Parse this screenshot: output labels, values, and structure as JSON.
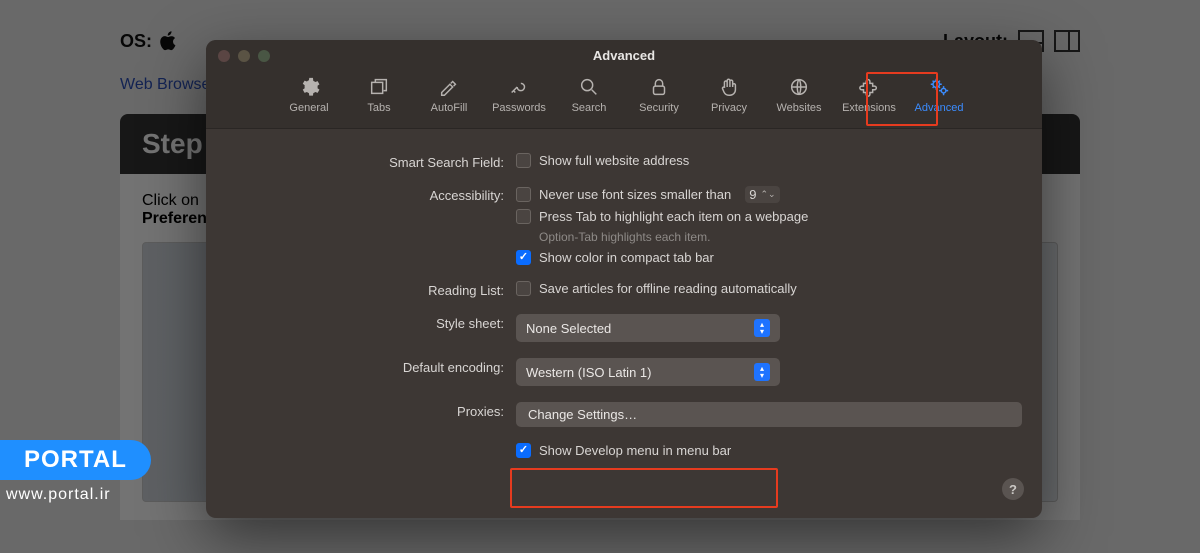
{
  "background": {
    "os_label": "OS:",
    "layout_label": "Layout:",
    "breadcrumb": "Web Browse",
    "step_title": "Step",
    "step_text_1": "Click on",
    "step_text_2": "Preferen"
  },
  "portal": {
    "name": "PORTAL",
    "url": "www.portal.ir"
  },
  "prefs": {
    "title": "Advanced",
    "toolbar": [
      {
        "id": "general",
        "label": "General"
      },
      {
        "id": "tabs",
        "label": "Tabs"
      },
      {
        "id": "autofill",
        "label": "AutoFill"
      },
      {
        "id": "passwords",
        "label": "Passwords"
      },
      {
        "id": "search",
        "label": "Search"
      },
      {
        "id": "security",
        "label": "Security"
      },
      {
        "id": "privacy",
        "label": "Privacy"
      },
      {
        "id": "websites",
        "label": "Websites"
      },
      {
        "id": "extensions",
        "label": "Extensions"
      },
      {
        "id": "advanced",
        "label": "Advanced"
      }
    ],
    "smart_search": {
      "label": "Smart Search Field:",
      "cb_full_address": "Show full website address"
    },
    "accessibility": {
      "label": "Accessibility:",
      "cb_font_size": "Never use font sizes smaller than",
      "font_value": "9",
      "cb_tab_highlight": "Press Tab to highlight each item on a webpage",
      "hint": "Option-Tab highlights each item.",
      "cb_compact_color": "Show color in compact tab bar"
    },
    "reading_list": {
      "label": "Reading List:",
      "cb_offline": "Save articles for offline reading automatically"
    },
    "style_sheet": {
      "label": "Style sheet:",
      "value": "None Selected"
    },
    "encoding": {
      "label": "Default encoding:",
      "value": "Western (ISO Latin 1)"
    },
    "proxies": {
      "label": "Proxies:",
      "button": "Change Settings…"
    },
    "develop": {
      "cb": "Show Develop menu in menu bar"
    },
    "help": "?"
  }
}
